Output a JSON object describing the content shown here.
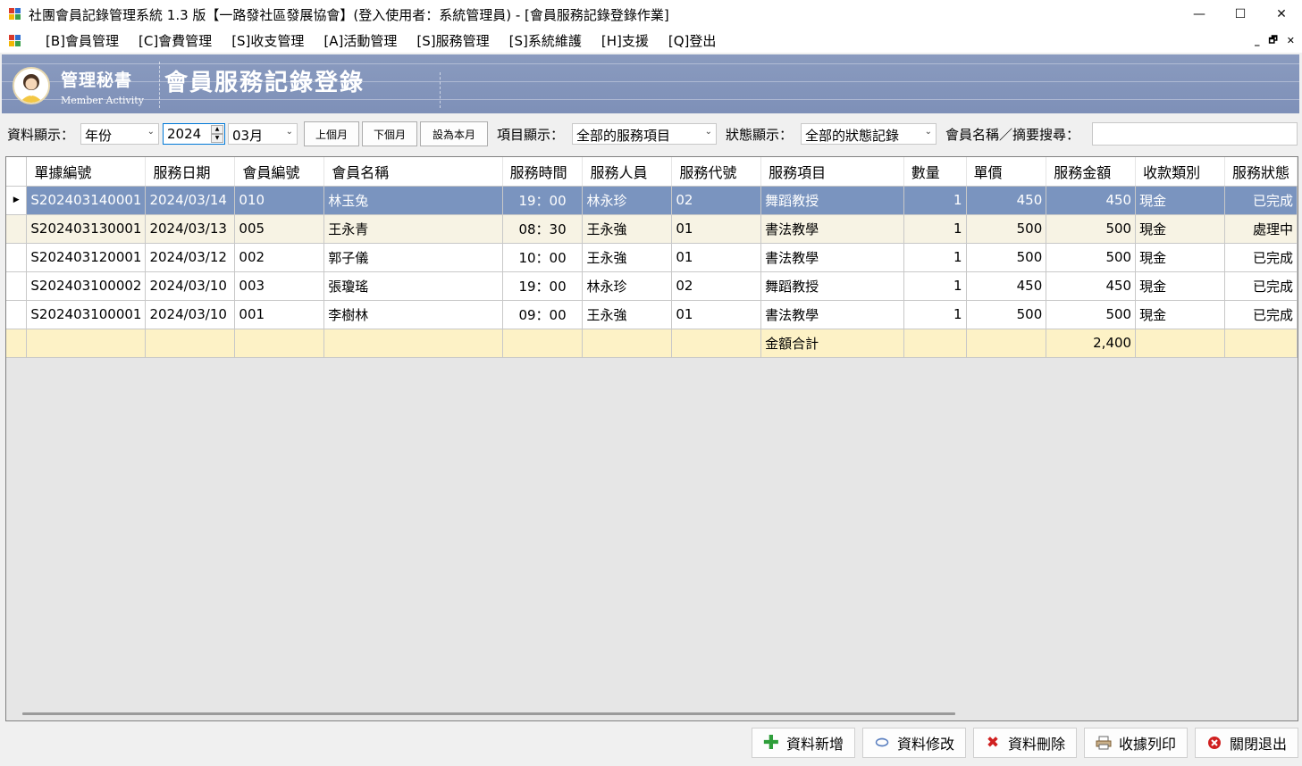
{
  "window": {
    "title": "社團會員記錄管理系統 1.3 版【一路發社區發展協會】(登入使用者：系統管理員) - [會員服務記錄登錄作業]",
    "minimize": "—",
    "maximize": "☐",
    "close": "✕"
  },
  "menu": {
    "items": [
      "[B]會員管理",
      "[C]會費管理",
      "[S]收支管理",
      "[A]活動管理",
      "[S]服務管理",
      "[S]系統維護",
      "[H]支援",
      "[Q]登出"
    ],
    "mdi_restore": "🗗",
    "mdi_close": "✕",
    "mdi_min": "_"
  },
  "banner": {
    "subtitle": "管理秘書",
    "subtitle_en": "Member Activity",
    "title": "會員服務記錄登錄"
  },
  "filter": {
    "display_label": "資料顯示：",
    "period_value": "年份",
    "year_value": "2024",
    "month_value": "03月",
    "prev_month": "上個月",
    "next_month": "下個月",
    "this_month": "設為本月",
    "item_label": "項目顯示：",
    "item_value": "全部的服務項目",
    "status_label": "狀態顯示：",
    "status_value": "全部的狀態記錄",
    "search_label": "會員名稱／摘要搜尋：",
    "search_value": ""
  },
  "table": {
    "columns": [
      "單據編號",
      "服務日期",
      "會員編號",
      "會員名稱",
      "服務時間",
      "服務人員",
      "服務代號",
      "服務項目",
      "數量",
      "單價",
      "服務金額",
      "收款類別",
      "服務狀態"
    ],
    "rows": [
      [
        "S202403140001",
        "2024/03/14",
        "010",
        "林玉兔",
        "19：00",
        "林永珍",
        "02",
        "舞蹈教授",
        "1",
        "450",
        "450",
        "現金",
        "已完成"
      ],
      [
        "S202403130001",
        "2024/03/13",
        "005",
        "王永青",
        "08：30",
        "王永強",
        "01",
        "書法教學",
        "1",
        "500",
        "500",
        "現金",
        "處理中"
      ],
      [
        "S202403120001",
        "2024/03/12",
        "002",
        "郭子儀",
        "10：00",
        "王永強",
        "01",
        "書法教學",
        "1",
        "500",
        "500",
        "現金",
        "已完成"
      ],
      [
        "S202403100002",
        "2024/03/10",
        "003",
        "張瓊瑤",
        "19：00",
        "林永珍",
        "02",
        "舞蹈教授",
        "1",
        "450",
        "450",
        "現金",
        "已完成"
      ],
      [
        "S202403100001",
        "2024/03/10",
        "001",
        "李樹林",
        "09：00",
        "王永強",
        "01",
        "書法教學",
        "1",
        "500",
        "500",
        "現金",
        "已完成"
      ]
    ],
    "total_label": "金額合計",
    "total_amount": "2,400",
    "selected_marker": "▶"
  },
  "actions": {
    "add": "資料新增",
    "edit": "資料修改",
    "delete": "資料刪除",
    "print": "收據列印",
    "exit": "關閉退出"
  },
  "colors": {
    "banner": "#8a9bbf",
    "selected_row": "#7a94bf",
    "alt_row": "#f7f3e4",
    "total_row": "#fdf2c6",
    "add_icon": "#2e9e3a",
    "delete_icon": "#d02020",
    "exit_icon": "#d02020"
  }
}
